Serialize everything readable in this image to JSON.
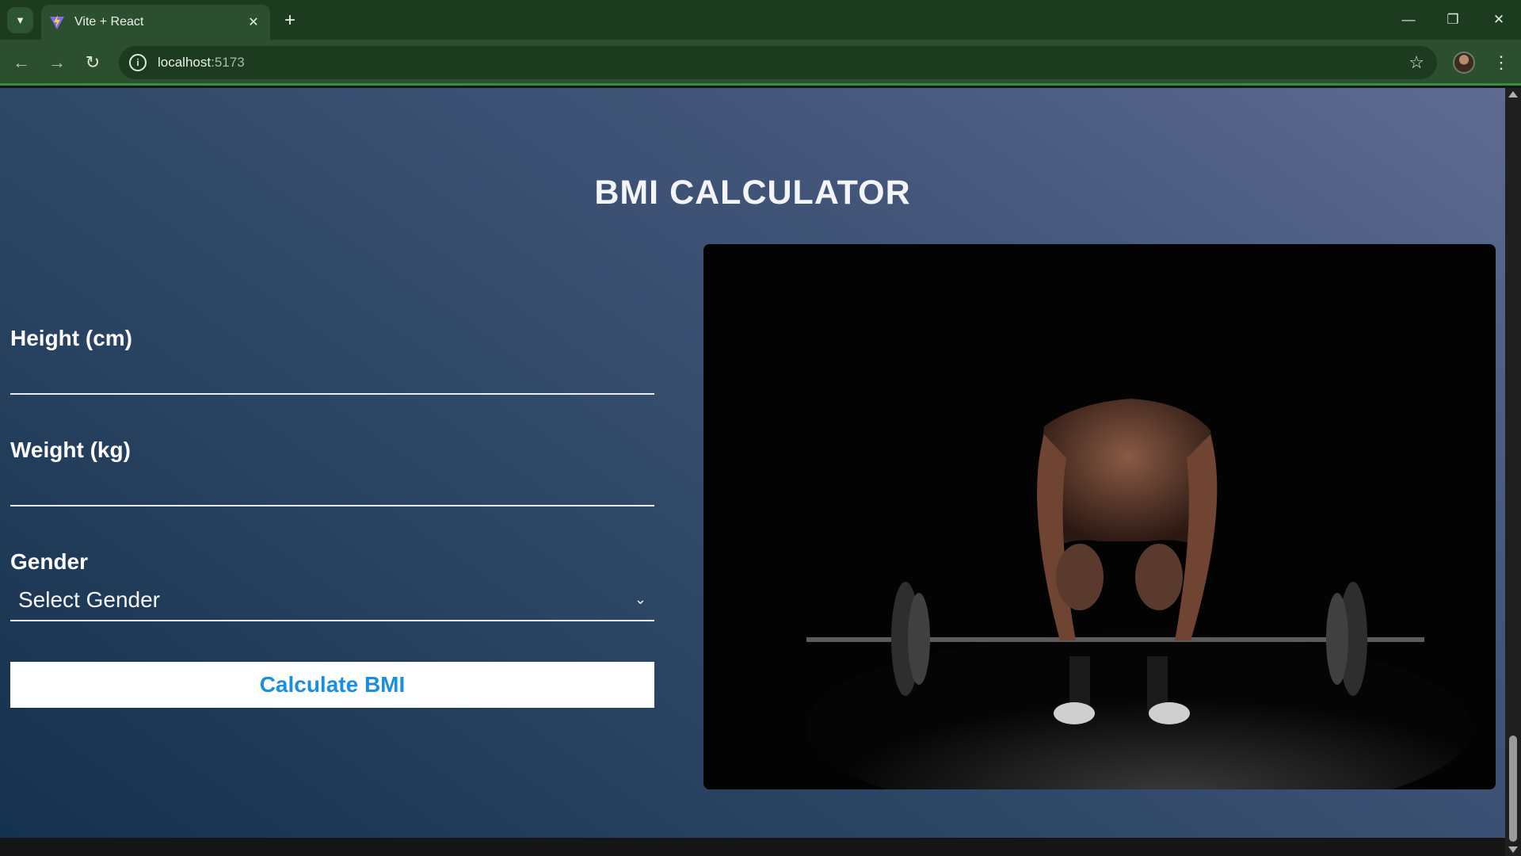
{
  "browser": {
    "tab_title": "Vite + React",
    "url_host": "localhost",
    "url_port": ":5173"
  },
  "page": {
    "heading": "BMI CALCULATOR",
    "height_label": "Height (cm)",
    "weight_label": "Weight (kg)",
    "gender_label": "Gender",
    "gender_select_value": "Select Gender",
    "calculate_label": "Calculate BMI"
  },
  "icons": {
    "tab_search": "chevron-down-icon",
    "favicon": "vite-logo-icon",
    "tab_close": "close-icon",
    "new_tab": "plus-icon",
    "back": "arrow-left-icon",
    "forward": "arrow-right-icon",
    "reload": "reload-icon",
    "site_info": "info-icon",
    "bookmark": "star-icon",
    "menu": "kebab-menu-icon"
  },
  "colors": {
    "browser_frame": "#1d3b1f",
    "button_text": "#1a8fe0"
  }
}
